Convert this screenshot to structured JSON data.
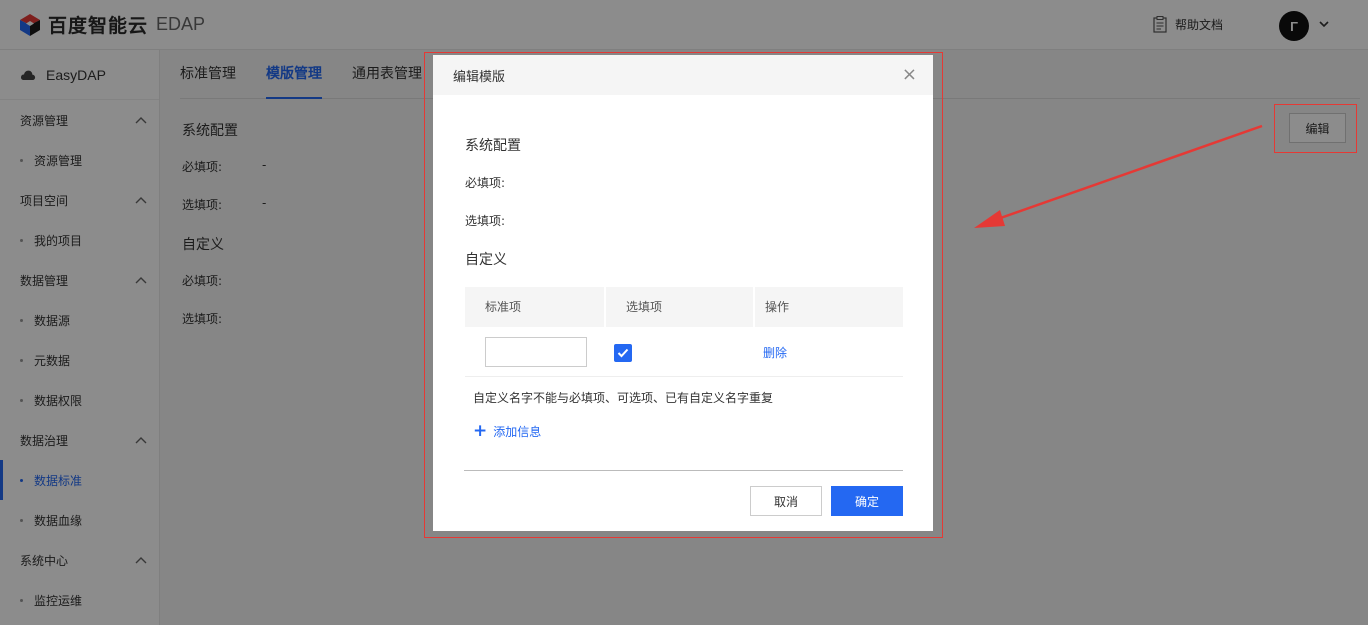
{
  "header": {
    "brand": "百度智能云",
    "product": "EDAP",
    "help_label": "帮助文档",
    "avatar_letter": "Γ"
  },
  "sidebar": {
    "title": "EasyDAP",
    "groups": [
      {
        "label": "资源管理",
        "items": [
          "资源管理"
        ]
      },
      {
        "label": "项目空间",
        "items": [
          "我的项目"
        ]
      },
      {
        "label": "数据管理",
        "items": [
          "数据源",
          "元数据",
          "数据权限"
        ]
      },
      {
        "label": "数据治理",
        "items": [
          "数据标准",
          "数据血缘"
        ]
      },
      {
        "label": "系统中心",
        "items": [
          "监控运维"
        ]
      }
    ],
    "active_item": "数据标准"
  },
  "tabs": [
    "标准管理",
    "模版管理",
    "通用表管理"
  ],
  "active_tab": "模版管理",
  "background": {
    "system_title": "系统配置",
    "required_label": "必填项:",
    "required_value": "-",
    "optional_label": "选填项:",
    "optional_value": "-",
    "custom_title": "自定义",
    "custom_required_label": "必填项:",
    "custom_optional_label": "选填项:",
    "edit_button": "编辑"
  },
  "modal": {
    "title": "编辑模版",
    "close_glyph": "×",
    "system_title": "系统配置",
    "required_label": "必填项:",
    "optional_label": "选填项:",
    "custom_title": "自定义",
    "table": {
      "headers": [
        "标准项",
        "选填项",
        "操作"
      ],
      "rows": [
        {
          "name_value": "",
          "optional_checked": true,
          "action": "删除"
        }
      ]
    },
    "hint": "自定义名字不能与必填项、可选项、已有自定义名字重复",
    "add_label": "添加信息",
    "cancel_label": "取消",
    "ok_label": "确定"
  },
  "colors": {
    "accent": "#2468f2",
    "highlight": "#e53935"
  }
}
